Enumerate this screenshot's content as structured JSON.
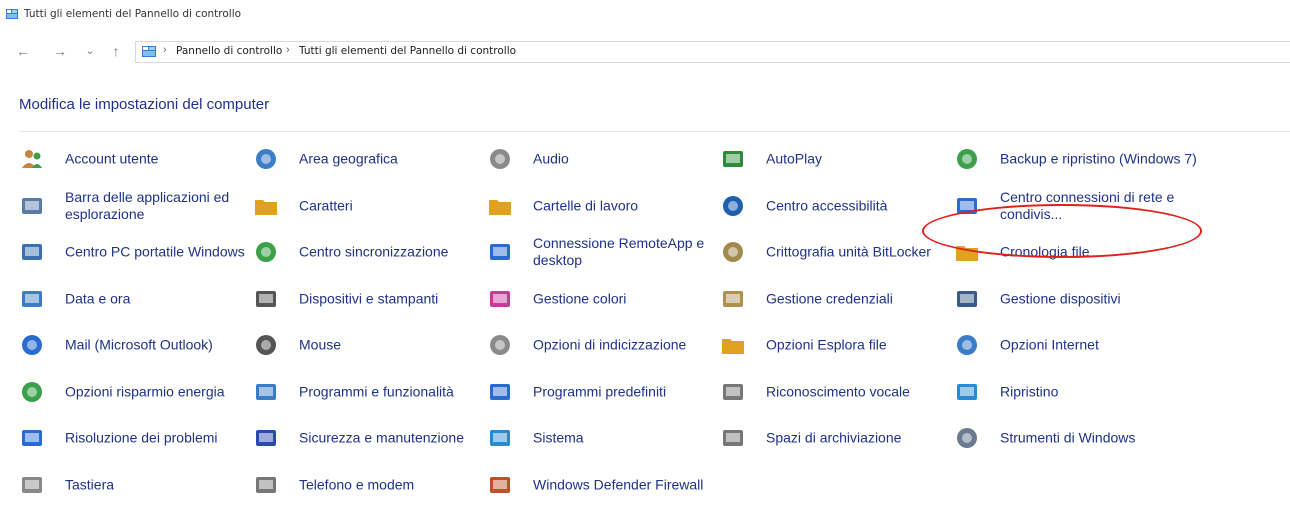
{
  "window": {
    "title": "Tutti gli elementi del Pannello di controllo"
  },
  "nav": {
    "back": "←",
    "forward": "→",
    "recent": "⌄",
    "up": "↑"
  },
  "address": {
    "crumbs": [
      "Pannello di controllo",
      "Tutti gli elementi del Pannello di controllo"
    ],
    "separator": "›"
  },
  "main": {
    "heading": "Modifica le impostazioni del computer"
  },
  "items": [
    {
      "label": "Account utente",
      "icon": "users-icon",
      "color": "#c8853a"
    },
    {
      "label": "Area geografica",
      "icon": "globe-clock-icon",
      "color": "#3c7dc8"
    },
    {
      "label": "Audio",
      "icon": "speaker-icon",
      "color": "#8a8a8a"
    },
    {
      "label": "AutoPlay",
      "icon": "autoplay-icon",
      "color": "#2f8a3a"
    },
    {
      "label": "Backup e ripristino (Windows 7)",
      "icon": "backup-icon",
      "color": "#3aa04a"
    },
    {
      "label": "Barra delle applicazioni ed esplorazione",
      "icon": "taskbar-icon",
      "color": "#5a7ca8"
    },
    {
      "label": "Caratteri",
      "icon": "fonts-icon",
      "color": "#e0a020"
    },
    {
      "label": "Cartelle di lavoro",
      "icon": "work-folders-icon",
      "color": "#e0a020"
    },
    {
      "label": "Centro accessibilità",
      "icon": "accessibility-icon",
      "color": "#1f5fb0"
    },
    {
      "label": "Centro connessioni di rete e condivis...",
      "icon": "network-icon",
      "color": "#2a6bd0"
    },
    {
      "label": "Centro PC portatile Windows",
      "icon": "mobility-icon",
      "color": "#3a6fb0"
    },
    {
      "label": "Centro sincronizzazione",
      "icon": "sync-icon",
      "color": "#3aa04a"
    },
    {
      "label": "Connessione RemoteApp e desktop",
      "icon": "remote-desktop-icon",
      "color": "#2a6bd0"
    },
    {
      "label": "Crittografia unità BitLocker",
      "icon": "bitlocker-icon",
      "color": "#a08a50"
    },
    {
      "label": "Cronologia file",
      "icon": "file-history-icon",
      "color": "#e0a020"
    },
    {
      "label": "Data e ora",
      "icon": "calendar-clock-icon",
      "color": "#3a7cc8"
    },
    {
      "label": "Dispositivi e stampanti",
      "icon": "printer-icon",
      "color": "#555555"
    },
    {
      "label": "Gestione colori",
      "icon": "color-management-icon",
      "color": "#c83a9a"
    },
    {
      "label": "Gestione credenziali",
      "icon": "credentials-icon",
      "color": "#b09050"
    },
    {
      "label": "Gestione dispositivi",
      "icon": "device-manager-icon",
      "color": "#3a5a8a"
    },
    {
      "label": "Mail (Microsoft Outlook)",
      "icon": "mail-icon",
      "color": "#2a6bd0"
    },
    {
      "label": "Mouse",
      "icon": "mouse-icon",
      "color": "#555555"
    },
    {
      "label": "Opzioni di indicizzazione",
      "icon": "indexing-icon",
      "color": "#8a8a8a"
    },
    {
      "label": "Opzioni Esplora file",
      "icon": "folder-options-icon",
      "color": "#e0a020"
    },
    {
      "label": "Opzioni Internet",
      "icon": "internet-options-icon",
      "color": "#3a7cc8"
    },
    {
      "label": "Opzioni risparmio energia",
      "icon": "power-icon",
      "color": "#3aa04a"
    },
    {
      "label": "Programmi e funzionalità",
      "icon": "programs-icon",
      "color": "#3a7cc8"
    },
    {
      "label": "Programmi predefiniti",
      "icon": "default-programs-icon",
      "color": "#2a6bd0"
    },
    {
      "label": "Riconoscimento vocale",
      "icon": "microphone-icon",
      "color": "#777777"
    },
    {
      "label": "Ripristino",
      "icon": "recovery-icon",
      "color": "#2a8ad0"
    },
    {
      "label": "Risoluzione dei problemi",
      "icon": "troubleshoot-icon",
      "color": "#2a6bd0"
    },
    {
      "label": "Sicurezza e manutenzione",
      "icon": "flag-icon",
      "color": "#2a4ab0"
    },
    {
      "label": "Sistema",
      "icon": "system-icon",
      "color": "#2a8ad0"
    },
    {
      "label": "Spazi di archiviazione",
      "icon": "storage-spaces-icon",
      "color": "#777777"
    },
    {
      "label": "Strumenti di Windows",
      "icon": "tools-icon",
      "color": "#6a7a90"
    },
    {
      "label": "Tastiera",
      "icon": "keyboard-icon",
      "color": "#888888"
    },
    {
      "label": "Telefono e modem",
      "icon": "phone-icon",
      "color": "#777777"
    },
    {
      "label": "Windows Defender Firewall",
      "icon": "firewall-icon",
      "color": "#c0502a"
    }
  ]
}
